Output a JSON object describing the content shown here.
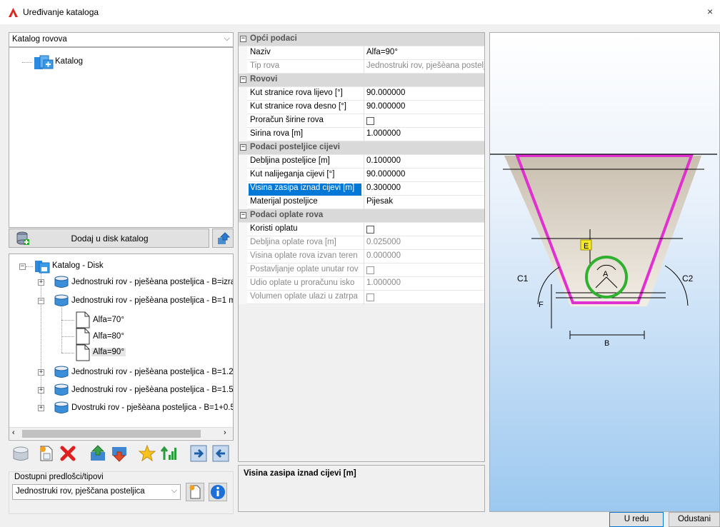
{
  "window": {
    "title": "Uređivanje kataloga",
    "close": "×"
  },
  "left": {
    "catalog_combo": "Katalog rovova",
    "tree_root": "Katalog",
    "add_disk_button": "Dodaj u disk katalog",
    "disk_root": "Katalog - Disk",
    "disk_items": [
      "Jednostruki rov - pješèana posteljica - B=izra",
      "Jednostruki rov - pješèana posteljica - B=1 m",
      "Jednostruki rov - pješèana posteljica - B=1.2",
      "Jednostruki rov - pješèana posteljica - B=1.5",
      "Dvostruki rov - pješèana posteljica - B=1+0.5"
    ],
    "sub_items": [
      "Alfa=70°",
      "Alfa=80°",
      "Alfa=90°"
    ],
    "templates_label": "Dostupni predlošci/tipovi",
    "template_combo": "Jednostruki rov, pješčana posteljica"
  },
  "grid": {
    "cat_general": "Opći podaci",
    "naziv": {
      "name": "Naziv",
      "value": "Alfa=90°"
    },
    "tip": {
      "name": "Tip rova",
      "value": "Jednostruki rov, pješèana posteljica"
    },
    "cat_rovovi": "Rovovi",
    "kut_lijevo": {
      "name": "Kut stranice rova lijevo [°]",
      "value": "90.000000"
    },
    "kut_desno": {
      "name": "Kut stranice rova desno [°]",
      "value": "90.000000"
    },
    "proracun": {
      "name": "Proračun širine rova",
      "value": false
    },
    "sirina": {
      "name": "Širina rova [m]",
      "value": "1.000000"
    },
    "cat_posteljica": "Podaci posteljice cijevi",
    "debljina": {
      "name": "Debljina posteljice [m]",
      "value": "0.100000"
    },
    "kut_nal": {
      "name": "Kut nalijeganja cijevi [°]",
      "value": "90.000000"
    },
    "visina_zas": {
      "name": "Visina zasipa iznad cijevi [m]",
      "value": "0.300000"
    },
    "materijal": {
      "name": "Materijal posteljice",
      "value": "Pijesak"
    },
    "cat_oplata": "Podaci oplate rova",
    "koristi": {
      "name": "Koristi oplatu",
      "value": false
    },
    "deb_oplate": {
      "name": "Debljina oplate rova [m]",
      "value": "0.025000"
    },
    "vis_oplate": {
      "name": "Visina oplate rova izvan teren",
      "value": "0.000000"
    },
    "postavljanje": {
      "name": "Postavljanje oplate unutar rov",
      "value": false
    },
    "udio": {
      "name": "Udio oplate u proračunu isko",
      "value": "1.000000"
    },
    "volumen": {
      "name": "Volumen oplate ulazi u zatrpa",
      "value": false
    }
  },
  "description": "Visina zasipa iznad cijevi [m]",
  "preview": {
    "labels": {
      "c1": "C1",
      "c2": "C2",
      "a": "A",
      "e": "E",
      "f": "F",
      "b": "B"
    }
  },
  "buttons": {
    "ok": "U redu",
    "cancel": "Odustani"
  }
}
